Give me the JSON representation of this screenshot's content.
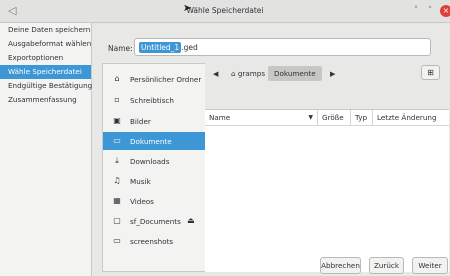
{
  "window": {
    "title": "Wähle Speicherdatei",
    "app_icon": "app-icon",
    "minimize_glyph": "˅",
    "maximize_glyph": "˄",
    "close_glyph": "×"
  },
  "sidebar": {
    "steps": [
      {
        "label": "Deine Daten speichern"
      },
      {
        "label": "Ausgabeformat wählen"
      },
      {
        "label": "Exportoptionen"
      },
      {
        "label": "Wähle Speicherdatei",
        "active": true
      },
      {
        "label": "Endgültige Bestätigung"
      },
      {
        "label": "Zusammenfassung"
      }
    ]
  },
  "filename": {
    "label": "Name:",
    "selected_part": "Untitled_1",
    "extension": ".ged"
  },
  "places": [
    {
      "icon": "home-icon",
      "label": "Persönlicher Ordner"
    },
    {
      "icon": "desktop-icon",
      "label": "Schreibtisch"
    },
    {
      "icon": "pictures-icon",
      "label": "Bilder"
    },
    {
      "icon": "documents-icon",
      "label": "Dokumente",
      "active": true
    },
    {
      "icon": "download-icon",
      "label": "Downloads"
    },
    {
      "icon": "music-icon",
      "label": "Musik"
    },
    {
      "icon": "videos-icon",
      "label": "Videos"
    },
    {
      "icon": "drive-icon",
      "label": "sf_Documents",
      "eject": true
    },
    {
      "icon": "folder-icon",
      "label": "screenshots"
    }
  ],
  "pathbar": {
    "home": "gramps",
    "current": "Dokumente"
  },
  "columns": {
    "name": "Name",
    "size": "Größe",
    "type": "Typ",
    "modified": "Letzte Änderung"
  },
  "buttons": {
    "abort": "Abbrechen",
    "back": "Zurück",
    "next": "Weiter"
  }
}
